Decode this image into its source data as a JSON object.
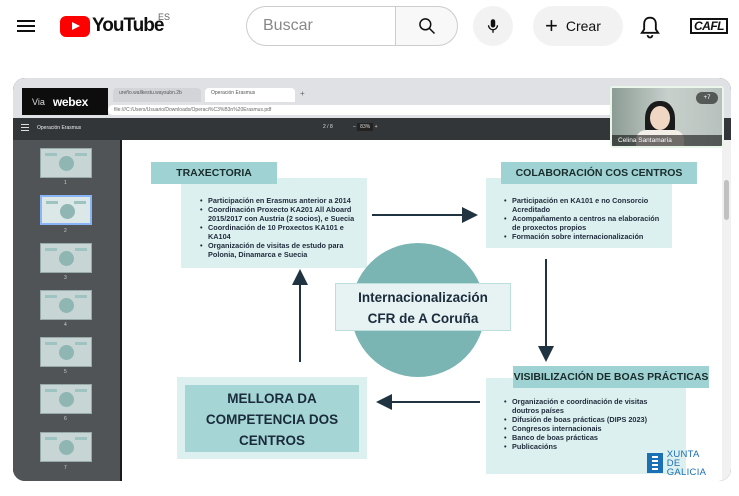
{
  "header": {
    "logo_text": "YouTube",
    "region": "ES",
    "search_placeholder": "Buscar",
    "create_label": "Crear",
    "avatar_text": "CAFL"
  },
  "video": {
    "browser": {
      "tab1_title": "ureño.wallkestu.waysubn.2b",
      "tab2_title": "Operación Erasmus",
      "url": "file:///C:/Users/Usuario/Downloads/Operaci%C3%B3n%20Erasmus.pdf",
      "webex_prefix": "Via",
      "webex_brand": "webex"
    },
    "pdf": {
      "title": "Operación Erasmus",
      "page": "2 / 8",
      "zoom": "83%",
      "thumb_numbers": [
        "1",
        "2",
        "3",
        "4",
        "5",
        "6",
        "7"
      ]
    },
    "slide": {
      "trax_title": "TRAXECTORIA",
      "trax_items": [
        "Participación en Erasmus anterior a 2014",
        "Coordinación Proxecto KA201 All Aboard 2015/2017 con Austria (2 socios), e Suecia",
        "Coordinación de 10 Proxectos KA101 e KA104",
        "Organización de visitas de estudo para Polonia, Dinamarca e Suecia"
      ],
      "colab_title": "COLABORACIÓN COS CENTROS",
      "colab_items": [
        "Participación en KA101 e no Consorcio Acreditado",
        "Acompañamento a centros na elaboración de proxectos propios",
        "Formación sobre internacionalización"
      ],
      "center_line1": "Internacionalización",
      "center_line2": "CFR de A Coruña",
      "visib_title": "VISIBILIZACIÓN DE BOAS PRÁCTICAS",
      "visib_items": [
        "Organización e coordinación de visitas doutros países",
        "Difusión de boas prácticas (DIPS 2023)",
        "Congresos internacionais",
        "Banco de boas prácticas",
        "Publicacións"
      ],
      "mellora_line1": "MELLORA DA",
      "mellora_line2": "COMPETENCIA DOS",
      "mellora_line3": "CENTROS",
      "xunta_line1": "XUNTA",
      "xunta_line2": "DE GALICIA"
    },
    "camera": {
      "participant_name": "Celina Santamaría",
      "participants_badge": "+7"
    }
  },
  "colors": {
    "youtube_red": "#ff0000",
    "slide_header": "#9fd3d3",
    "slide_box": "#ddf0f0",
    "circle": "#7ab5b3",
    "xunta_blue": "#1b6fb4"
  }
}
